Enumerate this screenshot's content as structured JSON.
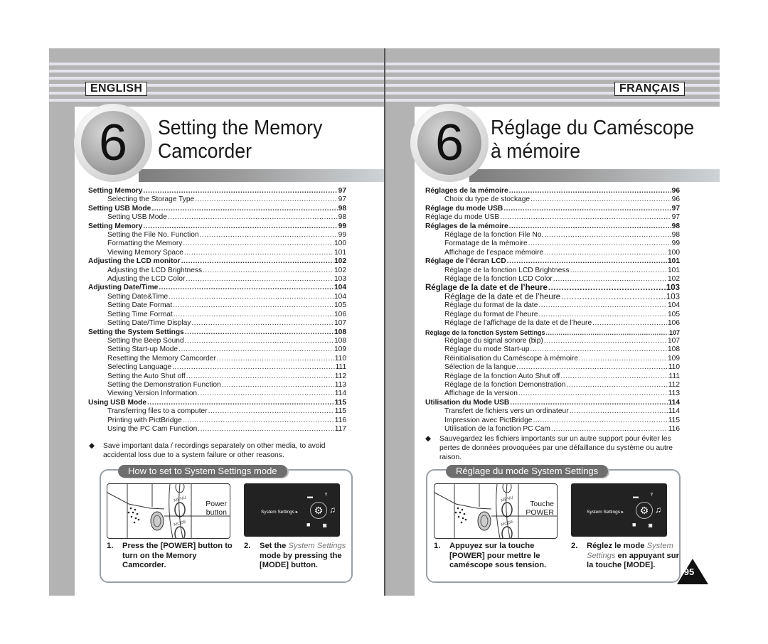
{
  "left_page": {
    "language": "ENGLISH",
    "chapter_number": "6",
    "title_line1": "Setting the Memory",
    "title_line2": "Camcorder",
    "toc": [
      {
        "label": "Setting Memory",
        "page": "97",
        "level": "h"
      },
      {
        "label": "Selecting the Storage Type",
        "page": "97",
        "level": "sub"
      },
      {
        "label": "Setting USB Mode",
        "page": "98",
        "level": "h"
      },
      {
        "label": "Setting USB Mode",
        "page": "98",
        "level": "sub"
      },
      {
        "label": "Setting Memory",
        "page": "99",
        "level": "h"
      },
      {
        "label": "Setting the File No. Function",
        "page": "99",
        "level": "sub"
      },
      {
        "label": "Formatting the Memory",
        "page": "100",
        "level": "sub"
      },
      {
        "label": "Viewing Memory Space",
        "page": "101",
        "level": "sub"
      },
      {
        "label": "Adjusting the LCD monitor",
        "page": "102",
        "level": "h"
      },
      {
        "label": "Adjusting the LCD Brightness",
        "page": "102",
        "level": "sub"
      },
      {
        "label": "Adjusting the LCD Color",
        "page": "103",
        "level": "sub"
      },
      {
        "label": "Adjusting Date/Time",
        "page": "104",
        "level": "h"
      },
      {
        "label": "Setting Date&Time",
        "page": "104",
        "level": "sub"
      },
      {
        "label": "Setting Date Format",
        "page": "105",
        "level": "sub"
      },
      {
        "label": "Setting Time Format",
        "page": "106",
        "level": "sub"
      },
      {
        "label": "Setting Date/Time Display",
        "page": "107",
        "level": "sub"
      },
      {
        "label": "Setting the System Settings",
        "page": "108",
        "level": "h"
      },
      {
        "label": "Setting the Beep Sound",
        "page": "108",
        "level": "sub"
      },
      {
        "label": "Setting Start-up Mode",
        "page": "109",
        "level": "sub"
      },
      {
        "label": "Resetting the Memory Camcorder",
        "page": "110",
        "level": "sub"
      },
      {
        "label": "Selecting Language",
        "page": "111",
        "level": "sub"
      },
      {
        "label": "Setting the Auto Shut off",
        "page": "112",
        "level": "sub"
      },
      {
        "label": "Setting the Demonstration Function",
        "page": "113",
        "level": "sub"
      },
      {
        "label": "Viewing Version Information",
        "page": "114",
        "level": "sub"
      },
      {
        "label": "Using USB Mode",
        "page": "115",
        "level": "h"
      },
      {
        "label": "Transferring files to a computer",
        "page": "115",
        "level": "sub"
      },
      {
        "label": "Printing with PictBridge",
        "page": "116",
        "level": "sub"
      },
      {
        "label": "Using the PC Cam Function",
        "page": "117",
        "level": "sub"
      }
    ],
    "note_bullet": "◆",
    "note": "Save important data / recordings separately on other media, to avoid accidental loss due to a system failure or other reasons.",
    "howto_title": "How to set to System Settings mode",
    "power_label_line1": "Power",
    "power_label_line2": "button",
    "screen_label": "System Settings ▸",
    "step1_num": "1.",
    "step1": "Press the [POWER] button to turn on the Memory Camcorder.",
    "step2_num": "2.",
    "step2_pre": "Set the ",
    "step2_italic": "System Settings",
    "step2_post": " mode by pressing the [MODE] button."
  },
  "right_page": {
    "language": "FRANÇAIS",
    "chapter_number": "6",
    "title_line1": "Réglage du Caméscope",
    "title_line2": "à mémoire",
    "toc": [
      {
        "label": "Réglages de la mémoire",
        "page": "96",
        "level": "h"
      },
      {
        "label": "Choix du type de stockage",
        "page": "96",
        "level": "sub"
      },
      {
        "label": "Réglage du mode USB",
        "page": "97",
        "level": "h"
      },
      {
        "label": "Réglage du mode USB",
        "page": "97",
        "level": "plain"
      },
      {
        "label": "Réglages de la mémoire",
        "page": "98",
        "level": "h"
      },
      {
        "label": "Réglage de la fonction File No.",
        "page": "98",
        "level": "sub"
      },
      {
        "label": "Formatage de la mémoire",
        "page": "99",
        "level": "sub"
      },
      {
        "label": "Affichage de l’espace mémoire",
        "page": "100",
        "level": "sub"
      },
      {
        "label": "Réglage de l’écran LCD",
        "page": "101",
        "level": "h"
      },
      {
        "label": "Réglage de la fonction LCD Brightness",
        "page": "101",
        "level": "sub"
      },
      {
        "label": "Réglage de la fonction LCD Color",
        "page": "102",
        "level": "sub"
      },
      {
        "label": "Réglage de la date et de l’heure",
        "page": "103",
        "level": "h-big"
      },
      {
        "label": "Réglage de la date et de l’heure",
        "page": "103",
        "level": "sub-big"
      },
      {
        "label": "Réglage du format de la date",
        "page": "104",
        "level": "sub"
      },
      {
        "label": "Réglage du format de l’heure",
        "page": "105",
        "level": "sub"
      },
      {
        "label": "Réglage de l’affichage de la date et de l’heure",
        "page": "106",
        "level": "sub"
      },
      {
        "label": "Réglage de la fonction System Settings",
        "page": "107",
        "level": "h-small"
      },
      {
        "label": "Réglage du signal sonore (bip)",
        "page": "107",
        "level": "sub"
      },
      {
        "label": "Réglage du mode Start-up",
        "page": "108",
        "level": "sub"
      },
      {
        "label": "Réinitialisation du Caméscope à mémoire",
        "page": "109",
        "level": "sub"
      },
      {
        "label": "Sélection de la langue",
        "page": "110",
        "level": "sub"
      },
      {
        "label": "Réglage de la fonction Auto Shut off",
        "page": "111",
        "level": "sub"
      },
      {
        "label": "Réglage de la fonction Demonstration",
        "page": "112",
        "level": "sub"
      },
      {
        "label": "Affichage de la version",
        "page": "113",
        "level": "sub"
      },
      {
        "label": "Utilisation du Mode USB",
        "page": "114",
        "level": "h"
      },
      {
        "label": "Transfert de fichiers vers un ordinateur",
        "page": "114",
        "level": "sub"
      },
      {
        "label": "Impression avec PictBridge",
        "page": "115",
        "level": "sub"
      },
      {
        "label": "Utilisation de la fonction PC Cam",
        "page": "116",
        "level": "sub"
      }
    ],
    "note_bullet": "◆",
    "note": "Sauvegardez les fichiers importants sur un autre support pour éviter les pertes de données provoquées par une défaillance du système ou autre raison.",
    "howto_title": "Réglage du mode System Settings",
    "power_label_line1": "Touche",
    "power_label_line2": "POWER",
    "screen_label": "System Settings ▸",
    "step1_num": "1.",
    "step1": "Appuyez sur la touche [POWER] pour mettre le caméscope sous tension.",
    "step2_num": "2.",
    "step2_pre": "Réglez le mode ",
    "step2_italic": "System Settings",
    "step2_post": " en appuyant sur la touche [MODE].",
    "page_number": "95"
  },
  "colors": {
    "band_gray": "#b3b3b3",
    "stripe": "#e4e4ec",
    "tab_gray": "#6e6e6e",
    "frame": "#9aa0a6"
  }
}
